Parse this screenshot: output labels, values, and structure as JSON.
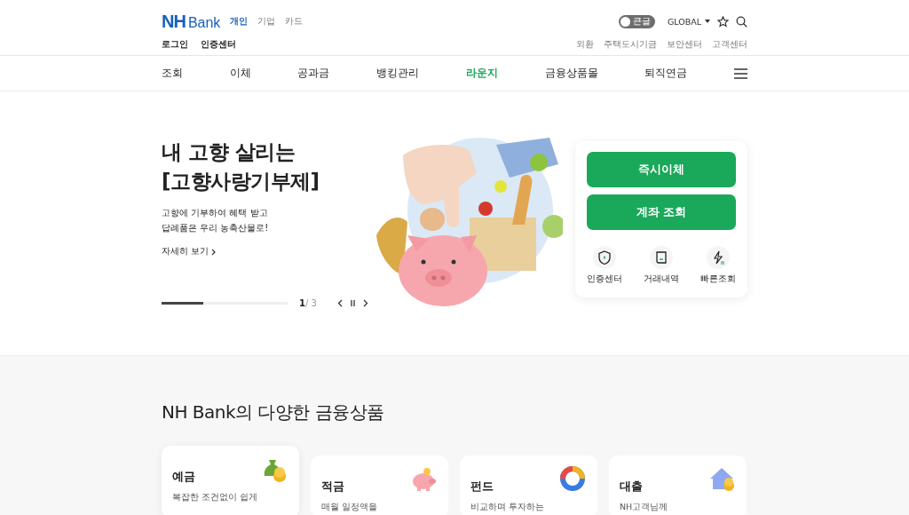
{
  "header": {
    "logo": {
      "mark": "NH",
      "text": "Bank"
    },
    "segments": [
      {
        "label": "개인",
        "selected": true
      },
      {
        "label": "기업",
        "selected": false
      },
      {
        "label": "카드",
        "selected": false
      }
    ],
    "large_text_toggle": {
      "label": "큰글",
      "on": false
    },
    "language": "GLOBAL",
    "account_links": [
      "로그인",
      "인증센터"
    ],
    "utility_links": [
      "외환",
      "주택도시기금",
      "보안센터",
      "고객센터"
    ]
  },
  "nav": [
    {
      "label": "조회",
      "selected": false
    },
    {
      "label": "이체",
      "selected": false
    },
    {
      "label": "공과금",
      "selected": false
    },
    {
      "label": "뱅킹관리",
      "selected": false
    },
    {
      "label": "라운지",
      "selected": true
    },
    {
      "label": "금융상품몰",
      "selected": false
    },
    {
      "label": "퇴직연금",
      "selected": false
    }
  ],
  "hero": {
    "title_lines": [
      "내 고향 살리는",
      "[고향사랑기부제]"
    ],
    "description_lines": [
      "고향에 기부하여 혜택 받고",
      "답례품은 우리 농축산물로!"
    ],
    "more_link": "자세히 보기",
    "progress": {
      "level": 0.33
    },
    "page_current": "1",
    "page_total": "/ 3"
  },
  "quick_panel": {
    "buttons": [
      "즉시이체",
      "계좌 조회"
    ],
    "shortcuts": [
      {
        "kind": "shield",
        "label": "인증센터"
      },
      {
        "kind": "receipt",
        "label": "거래내역"
      },
      {
        "kind": "bolt",
        "label": "빠른조회"
      }
    ]
  },
  "products": {
    "title": "NH Bank의 다양한 금융상품",
    "cards": [
      {
        "kind": "moneybag",
        "name": "예금",
        "description": "복잡한 조건없이 쉽게",
        "raised": true
      },
      {
        "kind": "piggy",
        "name": "적금",
        "description": "매월 일정액을",
        "raised": false
      },
      {
        "kind": "donut",
        "name": "펀드",
        "description": "비교하며 투자하는",
        "raised": false
      },
      {
        "kind": "house",
        "name": "대출",
        "description": "NH고객님께",
        "raised": false
      }
    ]
  }
}
